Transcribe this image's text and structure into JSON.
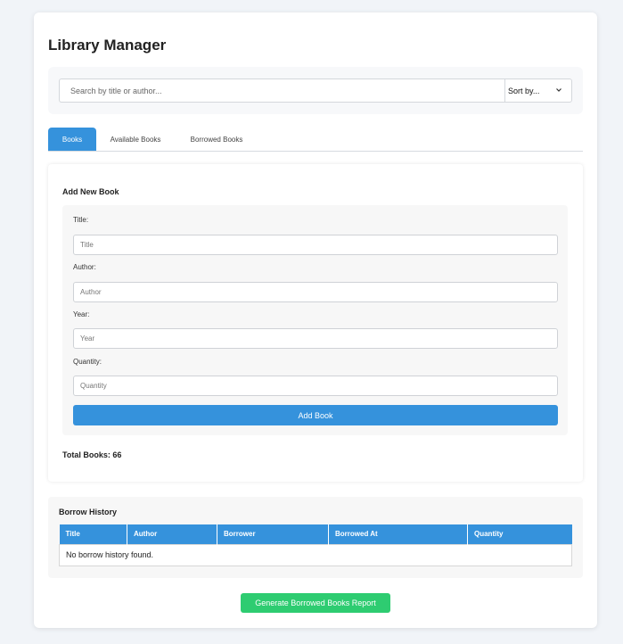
{
  "app": {
    "title": "Library Manager"
  },
  "search": {
    "placeholder": "Search by title or author...",
    "value": ""
  },
  "sort": {
    "label": "Sort by..."
  },
  "tabs": [
    {
      "label": "Books",
      "active": true
    },
    {
      "label": "Available Books",
      "active": false
    },
    {
      "label": "Borrowed Books",
      "active": false
    }
  ],
  "add_book": {
    "heading": "Add New Book",
    "fields": [
      {
        "label": "Title:",
        "placeholder": "Title",
        "value": ""
      },
      {
        "label": "Author:",
        "placeholder": "Author",
        "value": ""
      },
      {
        "label": "Year:",
        "placeholder": "Year",
        "value": ""
      },
      {
        "label": "Quantity:",
        "placeholder": "Quantity",
        "value": ""
      }
    ],
    "submit_label": "Add Book"
  },
  "total_books": "Total Books: 66",
  "history": {
    "heading": "Borrow History",
    "columns": [
      "Title",
      "Author",
      "Borrower",
      "Borrowed At",
      "Quantity"
    ],
    "empty_message": "No borrow history found."
  },
  "report_button": "Generate Borrowed Books Report",
  "colors": {
    "primary": "#3592dc",
    "success": "#2ecc71",
    "background": "#f1f4f8"
  },
  "icons": {
    "sort_chevron": "chevron-down-icon"
  }
}
